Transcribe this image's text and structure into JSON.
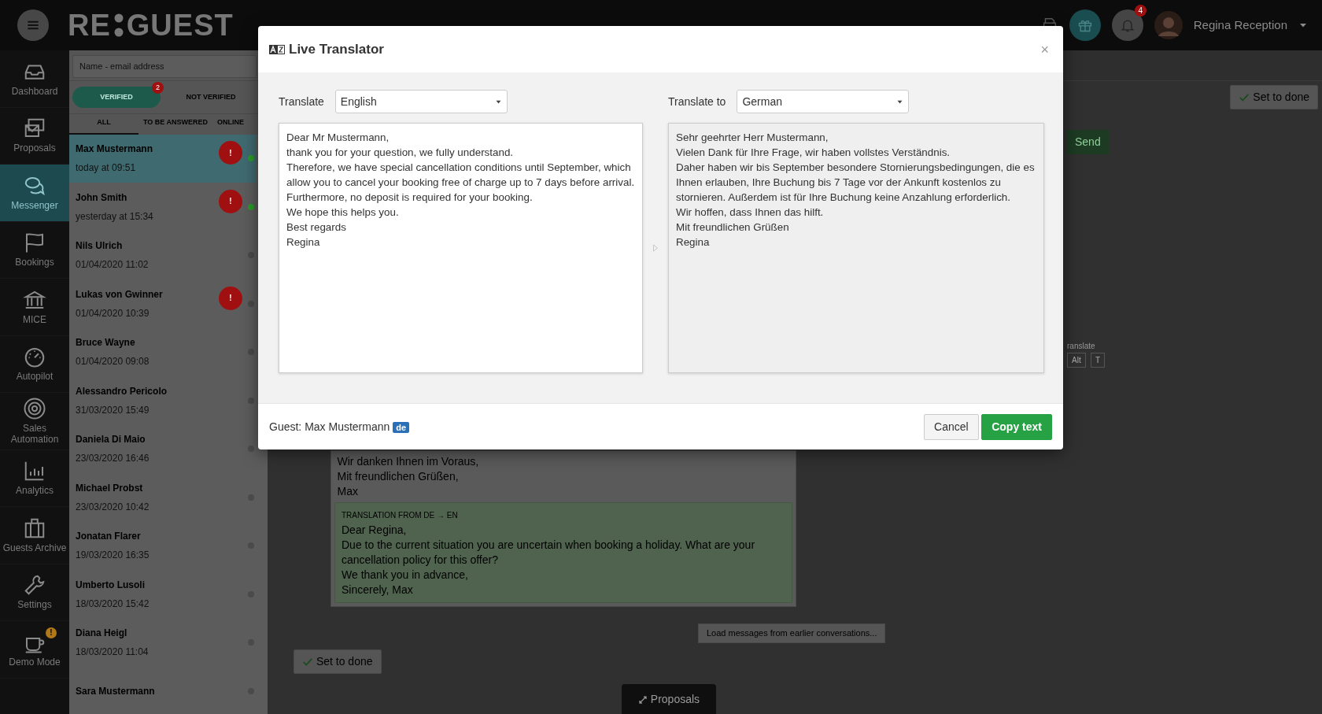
{
  "topbar": {
    "logo": [
      "RE",
      "GUEST"
    ],
    "notifications_badge": "4",
    "user_name": "Regina Reception"
  },
  "sidebar": {
    "items": [
      {
        "label": "Dashboard",
        "selected": false
      },
      {
        "label": "Proposals",
        "selected": false
      },
      {
        "label": "Messenger",
        "selected": true
      },
      {
        "label": "Bookings",
        "selected": false
      },
      {
        "label": "MICE",
        "selected": false
      },
      {
        "label": "Autopilot",
        "selected": false
      },
      {
        "label": "Sales Automation",
        "selected": false
      },
      {
        "label": "Analytics",
        "selected": false
      },
      {
        "label": "Guests Archive",
        "selected": false
      },
      {
        "label": "Settings",
        "selected": false
      },
      {
        "label": "Demo Mode",
        "selected": false,
        "badge": "!"
      }
    ]
  },
  "conversations": {
    "search": {
      "placeholder": "Name - email address"
    },
    "filters": [
      {
        "label": "VERIFIED",
        "selected": true,
        "badge": "2"
      },
      {
        "label": "NOT VERIFIED",
        "selected": false
      }
    ],
    "tabs": [
      {
        "label": "ALL",
        "selected": true
      },
      {
        "label": "TO BE ANSWERED",
        "selected": false
      },
      {
        "label": "ONLINE",
        "selected": false
      }
    ],
    "items": [
      {
        "name": "Max Mustermann",
        "time": "today at 09:51",
        "selected": true,
        "alert": "!",
        "online": true
      },
      {
        "name": "John Smith",
        "time": "yesterday at 15:34",
        "selected": false,
        "alert": "!",
        "online": true
      },
      {
        "name": "Nils Ulrich",
        "time": "01/04/2020 11:02",
        "selected": false,
        "online": false
      },
      {
        "name": "Lukas von Gwinner",
        "time": "01/04/2020 10:39",
        "selected": false,
        "alert": "!",
        "online": false
      },
      {
        "name": "Bruce Wayne",
        "time": "01/04/2020 09:08",
        "selected": false,
        "online": false
      },
      {
        "name": "Alessandro Pericolo",
        "time": "31/03/2020 15:49",
        "selected": false,
        "online": false
      },
      {
        "name": "Daniela Di Maio",
        "time": "23/03/2020 16:46",
        "selected": false,
        "online": false
      },
      {
        "name": "Michael Probst",
        "time": "23/03/2020 10:42",
        "selected": false,
        "online": false
      },
      {
        "name": "Jonatan Flarer",
        "time": "19/03/2020 16:35",
        "selected": false,
        "online": false
      },
      {
        "name": "Umberto Lusoli",
        "time": "18/03/2020 15:42",
        "selected": false,
        "online": false
      },
      {
        "name": "Diana Heigl",
        "time": "18/03/2020 11:04",
        "selected": false,
        "online": false
      },
      {
        "name": "Sara Mustermann",
        "selected": false,
        "online": false
      }
    ]
  },
  "chat": {
    "set_to_done_top": "Set to done",
    "send": "Send",
    "translate_hint": "ranslate",
    "keys": [
      "Alt",
      "T"
    ],
    "message_lines": [
      "Wir danken Ihnen im Voraus,",
      "Mit freundlichen Grüßen,",
      "Max"
    ],
    "translation": {
      "label": "TRANSLATION FROM DE → EN",
      "lines": [
        "Dear Regina,",
        "Due to the current situation you are uncertain when booking a holiday. What are your cancellation policy for this offer?",
        "We thank you in advance,",
        "Sincerely, Max"
      ]
    },
    "load_more": "Load messages from earlier conversations...",
    "set_to_done_bottom": "Set to done",
    "proposals_tab": "Proposals"
  },
  "modal": {
    "title": "Live Translator",
    "close": "×",
    "source": {
      "label": "Translate",
      "language": "English",
      "text": "Dear Mr Mustermann,\nthank you for your question, we fully understand.\nTherefore, we have special cancellation conditions until September, which allow you to cancel your booking free of charge up to 7 days before arrival. Furthermore, no deposit is required for your booking.\nWe hope this helps you.\nBest regards\nRegina"
    },
    "target": {
      "label": "Translate to",
      "language": "German",
      "text": "Sehr geehrter Herr Mustermann,\nVielen Dank für Ihre Frage, wir haben vollstes Verständnis.\nDaher haben wir bis September besondere Stornierungsbedingungen, die es Ihnen erlauben, Ihre Buchung bis 7 Tage vor der Ankunft kostenlos zu stornieren. Außerdem ist für Ihre Buchung keine Anzahlung erforderlich.\nWir hoffen, dass Ihnen das hilft.\nMit freundlichen Grüßen\nRegina"
    },
    "guest": "Guest: Max Mustermann",
    "guest_language": "de",
    "buttons": [
      {
        "label": "Cancel",
        "kind": "secondary"
      },
      {
        "label": "Copy text",
        "kind": "primary"
      }
    ]
  }
}
